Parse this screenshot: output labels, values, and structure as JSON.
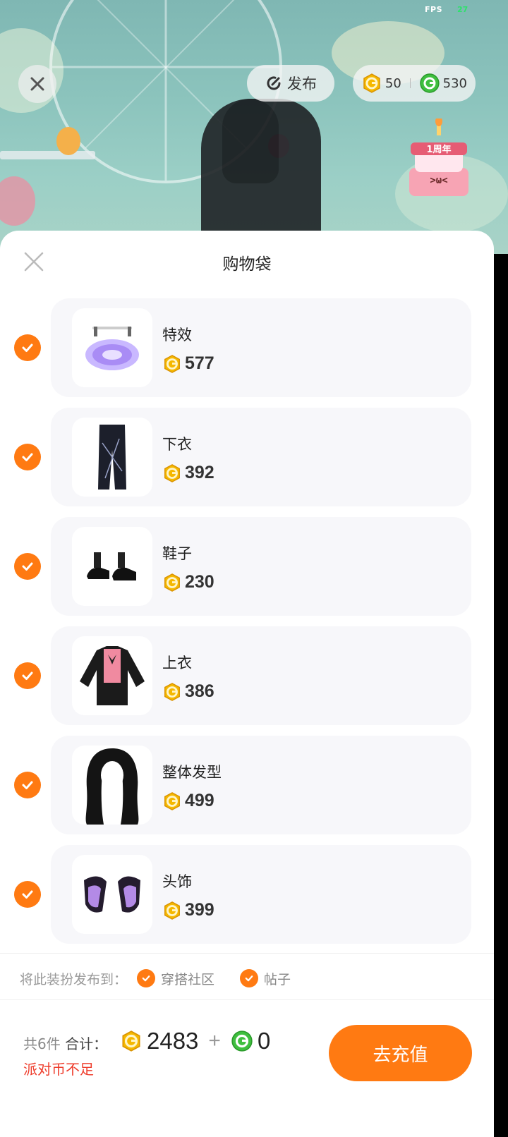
{
  "status": {
    "fps_label": "FPS",
    "fps_value": "27"
  },
  "topbar": {
    "publish_label": "发布",
    "gold_amount": "50",
    "green_amount": "530",
    "cake_text": "1周年"
  },
  "sheet": {
    "title": "购物袋",
    "items": [
      {
        "name": "特效",
        "price": "577",
        "checked": true,
        "icon": "effect-ring-icon"
      },
      {
        "name": "下衣",
        "price": "392",
        "checked": true,
        "icon": "pants-icon"
      },
      {
        "name": "鞋子",
        "price": "230",
        "checked": true,
        "icon": "shoes-icon"
      },
      {
        "name": "上衣",
        "price": "386",
        "checked": true,
        "icon": "jacket-icon"
      },
      {
        "name": "整体发型",
        "price": "499",
        "checked": true,
        "icon": "hair-icon"
      },
      {
        "name": "头饰",
        "price": "399",
        "checked": true,
        "icon": "ears-icon"
      }
    ],
    "publish_to": {
      "label": "将此装扮发布到：",
      "options": [
        {
          "label": "穿搭社区",
          "checked": true
        },
        {
          "label": "帖子",
          "checked": true
        }
      ]
    },
    "footer": {
      "count_label": "共6件",
      "total_label": "合计：",
      "gold_total": "2483",
      "plus": "+",
      "green_total": "0",
      "warning": "派对币不足",
      "recharge_label": "去充值"
    }
  },
  "colors": {
    "accent": "#ff7a12",
    "warning": "#ee3b2a",
    "gold": "#f5b800",
    "green": "#3fbf3f"
  }
}
